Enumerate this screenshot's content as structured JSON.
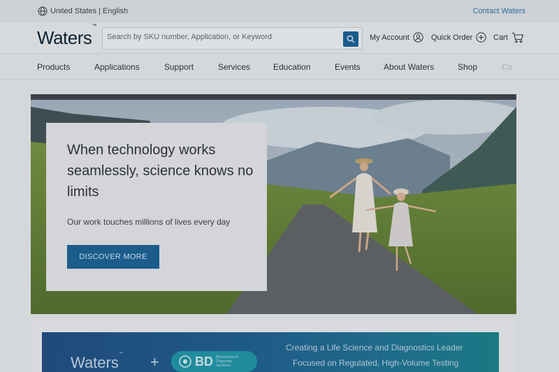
{
  "topbar": {
    "locale": "United States | English",
    "contact": "Contact Waters"
  },
  "header": {
    "logo": "Waters",
    "logo_mark": "™",
    "search_placeholder": "Search by SKU number, Application, or Keyword",
    "my_account": "My Account",
    "quick_order": "Quick Order",
    "cart": "Cart"
  },
  "nav": {
    "items": [
      "Products",
      "Applications",
      "Support",
      "Services",
      "Education",
      "Events",
      "About Waters",
      "Shop",
      "Co"
    ]
  },
  "hero": {
    "title": "When technology works seamlessly, science knows no limits",
    "subtitle": "Our work touches millions of lives every day",
    "cta": "DISCOVER MORE"
  },
  "promo": {
    "waters": "Waters",
    "waters_mark": "™",
    "plus": "+",
    "bd": "BD",
    "bd_small": "Biosciences & Diagnostic Solutions",
    "line1": "Creating a Life Science and Diagnostics Leader",
    "line2": "Focused on Regulated, High-Volume Testing"
  },
  "colors": {
    "brand_blue": "#1b5c8c",
    "link_blue": "#2d6e9b"
  }
}
